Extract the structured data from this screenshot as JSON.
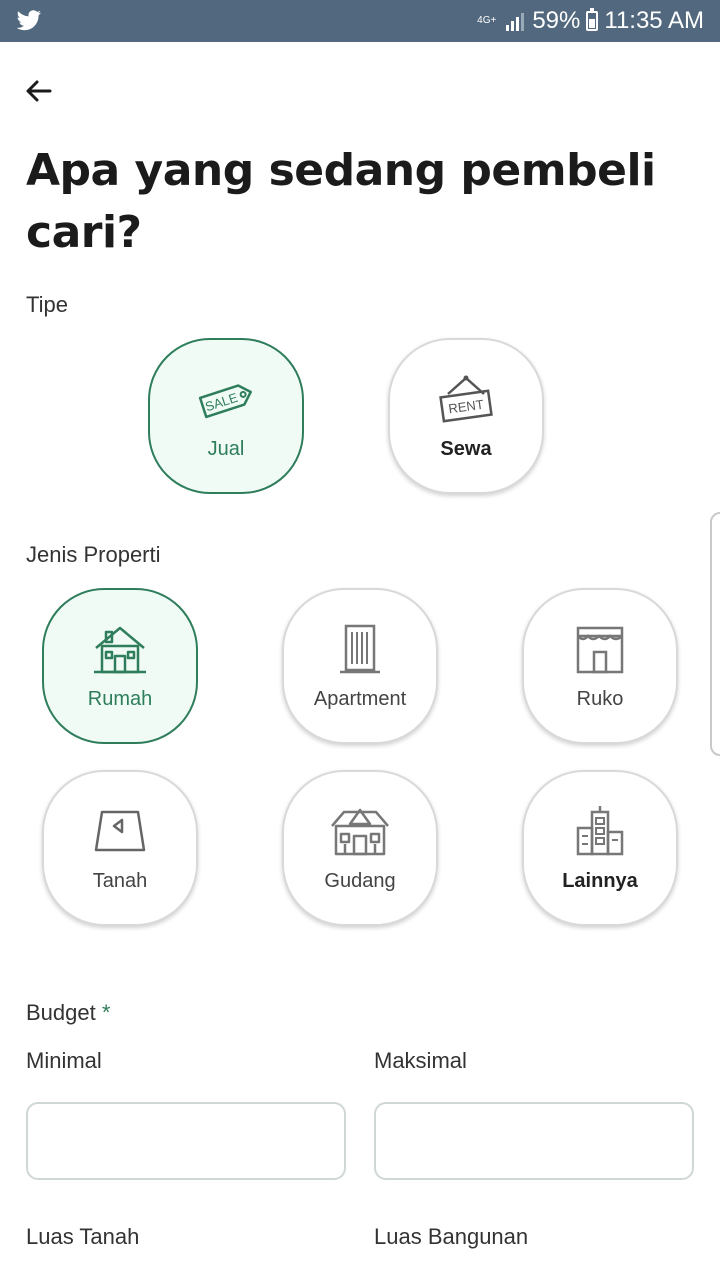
{
  "status": {
    "network": "4G+",
    "battery": "59%",
    "time": "11:35 AM"
  },
  "page": {
    "title": "Apa yang sedang pembeli cari?"
  },
  "tipe": {
    "label": "Tipe",
    "options": [
      {
        "label": "Jual",
        "icon": "sale-tag-icon",
        "selected": true
      },
      {
        "label": "Sewa",
        "icon": "rent-sign-icon",
        "selected": false
      }
    ],
    "icon_text": {
      "sale": "SALE",
      "rent": "RENT"
    }
  },
  "jenis": {
    "label": "Jenis Properti",
    "options": [
      {
        "label": "Rumah",
        "icon": "house-icon",
        "selected": true
      },
      {
        "label": "Apartment",
        "icon": "apartment-icon",
        "selected": false
      },
      {
        "label": "Ruko",
        "icon": "shophouse-icon",
        "selected": false
      },
      {
        "label": "Tanah",
        "icon": "land-icon",
        "selected": false
      },
      {
        "label": "Gudang",
        "icon": "warehouse-icon",
        "selected": false
      },
      {
        "label": "Lainnya",
        "icon": "buildings-icon",
        "selected": false
      }
    ]
  },
  "budget": {
    "label": "Budget",
    "required_mark": "*",
    "min_label": "Minimal",
    "max_label": "Maksimal",
    "min_value": "",
    "max_value": ""
  },
  "area": {
    "land_label": "Luas Tanah",
    "building_label": "Luas Bangunan"
  },
  "colors": {
    "accent": "#2e7d5b",
    "status_bar": "#52687e"
  }
}
